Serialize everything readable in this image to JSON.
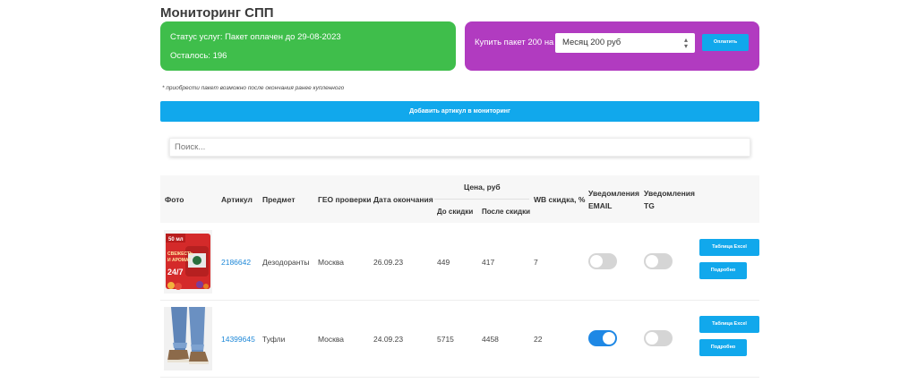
{
  "page": {
    "title": "Мониторинг СПП"
  },
  "status": {
    "line1": "Статус услуг: Пакет оплачен до 29-08-2023",
    "line2": "Осталось: 196"
  },
  "buy": {
    "label": "Купить пакет 200 на",
    "selected": "Месяц 200 руб",
    "pay_label": "Оплатить"
  },
  "note": "* приобрести пакет возможно после окончания ранее купленного",
  "add_button": "Добавить артикул в мониторинг",
  "search": {
    "placeholder": "Поиск..."
  },
  "colors": {
    "green": "#3fbe4b",
    "purple": "#b13bc0",
    "blue": "#11a8ec",
    "toggle_on": "#1e88e5"
  },
  "table": {
    "headers": {
      "photo": "Фото",
      "article": "Артикул",
      "subject": "Предмет",
      "geo": "ГЕО проверки",
      "end_date": "Дата окончания",
      "price": "Цена, руб",
      "before": "До скидки",
      "after": "После скидки",
      "wb_discount": "WB скидка, %",
      "email_1": "Уведомления",
      "email_2": "EMAIL",
      "tg_1": "Уведомления",
      "tg_2": "TG"
    },
    "rows": [
      {
        "photo_icon": "deodorant-product-photo",
        "photo_text_1": "50 мл",
        "photo_text_2": "24/7",
        "article": "2186642",
        "subject": "Дезодоранты",
        "geo": "Москва",
        "end_date": "26.09.23",
        "before": "449",
        "after": "417",
        "wb_discount": "7",
        "email_on": false,
        "tg_on": false,
        "table_btn": "Таблица Excel",
        "detail_btn": "Подробно"
      },
      {
        "photo_icon": "shoes-product-photo",
        "article": "14399645",
        "subject": "Туфли",
        "geo": "Москва",
        "end_date": "24.09.23",
        "before": "5715",
        "after": "4458",
        "wb_discount": "22",
        "email_on": true,
        "tg_on": false,
        "table_btn": "Таблица Excel",
        "detail_btn": "Подробно"
      }
    ]
  }
}
